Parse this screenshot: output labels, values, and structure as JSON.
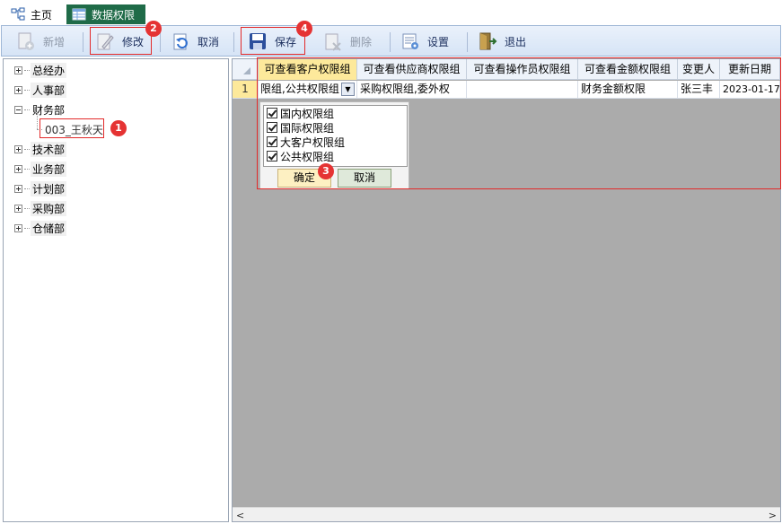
{
  "tabs": {
    "home": "主页",
    "active": "数据权限"
  },
  "toolbar": {
    "add": "新增",
    "edit": "修改",
    "cancel": "取消",
    "save": "保存",
    "delete": "删除",
    "settings": "设置",
    "exit": "退出"
  },
  "tree": {
    "nodes": [
      "总经办",
      "人事部",
      "财务部",
      "技术部",
      "业务部",
      "计划部",
      "采购部",
      "仓储部"
    ],
    "child": "003_王秋天"
  },
  "grid": {
    "columns": [
      "可查看客户权限组",
      "可查看供应商权限组",
      "可查看操作员权限组",
      "可查看金额权限组",
      "变更人",
      "更新日期"
    ],
    "row": {
      "num": "1",
      "customer": "限组,公共权限组",
      "supplier": "采购权限组,委外权",
      "operator": "",
      "amount": "财务金额权限",
      "changer": "张三丰",
      "date": "2023-01-17"
    },
    "popup": {
      "options": [
        "国内权限组",
        "国际权限组",
        "大客户权限组",
        "公共权限组"
      ],
      "ok": "确定",
      "cancel": "取消"
    }
  },
  "badges": [
    "1",
    "2",
    "3",
    "4"
  ],
  "colors": {
    "accent_tab": "#1f6b48",
    "highlight": "#e22a2a",
    "header_active": "#fde99b"
  }
}
